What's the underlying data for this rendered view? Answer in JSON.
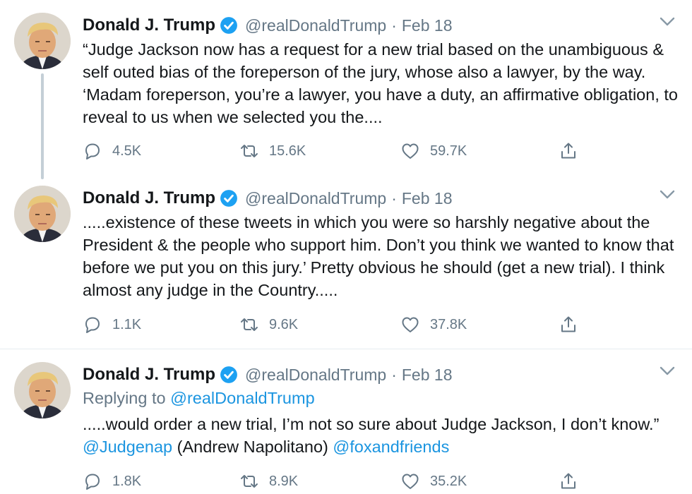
{
  "tweets": [
    {
      "name": "Donald J. Trump",
      "handle": "@realDonaldTrump",
      "separator": "·",
      "date": "Feb 18",
      "text": "“Judge Jackson now has a request for a new trial based on the unambiguous & self outed bias of the foreperson of the jury, whose also a lawyer, by the way. ‘Madam foreperson, you’re a lawyer, you have a duty, an affirmative obligation, to reveal to us when we selected you the....",
      "replies": "4.5K",
      "retweets": "15.6K",
      "likes": "59.7K"
    },
    {
      "name": "Donald J. Trump",
      "handle": "@realDonaldTrump",
      "separator": "·",
      "date": "Feb 18",
      "text": ".....existence of these tweets in which you were so harshly negative about the President & the people who support him. Don’t you think we wanted to know that before we put you on this jury.’ Pretty obvious he should (get a new trial). I think almost any judge in the Country.....",
      "replies": "1.1K",
      "retweets": "9.6K",
      "likes": "37.8K"
    },
    {
      "name": "Donald J. Trump",
      "handle": "@realDonaldTrump",
      "separator": "·",
      "date": "Feb 18",
      "replying_label": "Replying to",
      "replying_handle": "@realDonaldTrump",
      "text_part1": ".....would order a new trial, I’m not so sure about Judge Jackson, I don’t know.” ",
      "mention1": "@Judgenap",
      "text_part2": " (Andrew Napolitano) ",
      "mention2": "@foxandfriends",
      "replies": "1.8K",
      "retweets": "8.9K",
      "likes": "35.2K"
    }
  ],
  "icons": {
    "avatar": "avatar-photo",
    "verified": "verified-badge-icon",
    "menu": "chevron-down-icon",
    "reply": "reply-icon",
    "retweet": "retweet-icon",
    "like": "heart-icon",
    "share": "share-icon"
  },
  "colors": {
    "text": "#14171a",
    "secondary": "#657786",
    "link": "#1b95e0",
    "verified": "#1da1f2",
    "divider": "#e6ecf0",
    "thread_line": "#c4cfd6"
  }
}
